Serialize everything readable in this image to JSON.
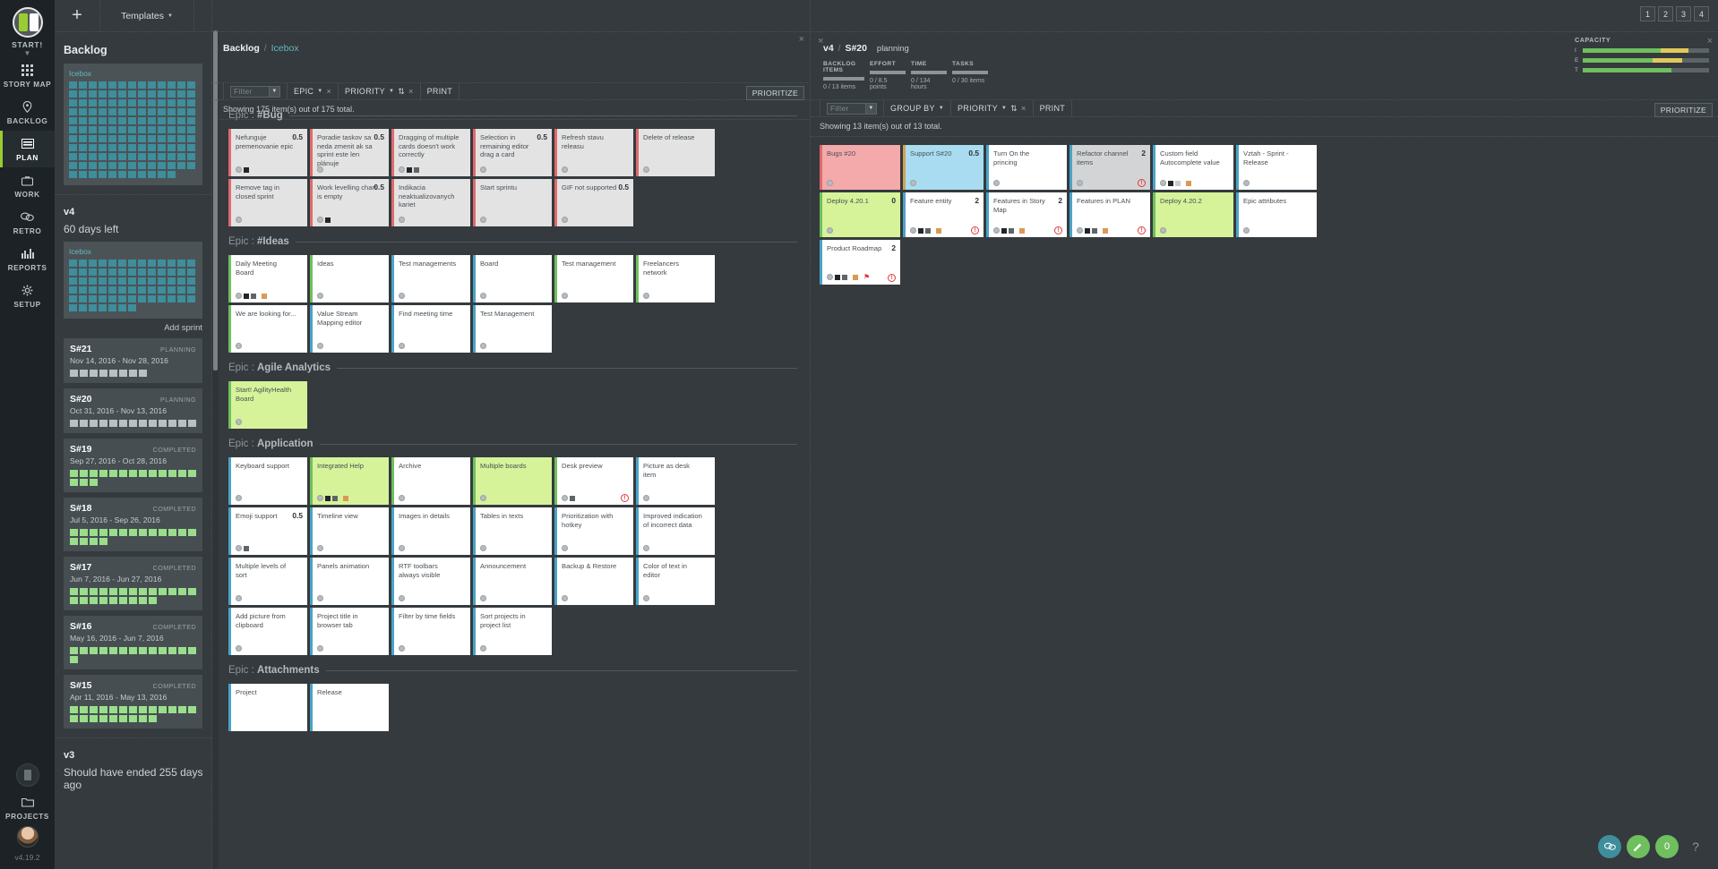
{
  "topbar": {
    "add_label": "+",
    "templates_label": "Templates",
    "pages": [
      "1",
      "2",
      "3",
      "4"
    ]
  },
  "rail": {
    "brand": "START!",
    "items": [
      {
        "label": "STORY MAP",
        "icon": "grid-icon"
      },
      {
        "label": "BACKLOG",
        "icon": "pin-icon"
      },
      {
        "label": "PLAN",
        "icon": "board-icon"
      },
      {
        "label": "WORK",
        "icon": "briefcase-icon"
      },
      {
        "label": "RETRO",
        "icon": "chat-icon"
      },
      {
        "label": "REPORTS",
        "icon": "bars-icon"
      },
      {
        "label": "SETUP",
        "icon": "gear-icon"
      }
    ],
    "projects_label": "PROJECTS",
    "version": "v4.19.2"
  },
  "sidebar": {
    "title": "Backlog",
    "icebox_label": "Icebox",
    "backlog_icebox_chips": 141,
    "release": {
      "name": "v4",
      "subtitle": "60 days left"
    },
    "release_icebox_chips": 72,
    "add_sprint_label": "Add sprint",
    "sprints": [
      {
        "name": "S#21",
        "dates": "Nov 14, 2016 - Nov 28, 2016",
        "status": "PLANNING",
        "chips": 8,
        "color": "grey"
      },
      {
        "name": "S#20",
        "dates": "Oct 31, 2016 - Nov 13, 2016",
        "status": "PLANNING",
        "chips": 13,
        "color": "grey"
      },
      {
        "name": "S#19",
        "dates": "Sep 27, 2016 - Oct 28, 2016",
        "status": "COMPLETED",
        "chips": 16,
        "color": "green"
      },
      {
        "name": "S#18",
        "dates": "Jul 5, 2016 - Sep 26, 2016",
        "status": "COMPLETED",
        "chips": 17,
        "color": "green"
      },
      {
        "name": "S#17",
        "dates": "Jun 7, 2016 - Jun 27, 2016",
        "status": "COMPLETED",
        "chips": 22,
        "color": "green"
      },
      {
        "name": "S#16",
        "dates": "May 16, 2016 - Jun 7, 2016",
        "status": "COMPLETED",
        "chips": 14,
        "color": "green"
      },
      {
        "name": "S#15",
        "dates": "Apr 11, 2016 - May 13, 2016",
        "status": "COMPLETED",
        "chips": 22,
        "color": "green"
      }
    ],
    "release2": {
      "name": "v3",
      "subtitle": "Should have ended 255 days ago"
    }
  },
  "center": {
    "breadcrumb_root": "Backlog",
    "breadcrumb_sep": "/",
    "breadcrumb_current": "Icebox",
    "toolbar": {
      "filter_placeholder": "Filter",
      "epic_label": "EPIC",
      "priority_label": "PRIORITY",
      "print_label": "PRINT",
      "prioritize_label": "PRIORITIZE",
      "clear_label": "×",
      "sort_icon": "sort-icon"
    },
    "showing": "Showing 175 item(s) out of 175 total.",
    "epics": [
      {
        "label_prefix": "Epic :",
        "name": "#Bug",
        "cards": [
          {
            "title": "Nefunguje premenovanie epic",
            "points": "0.5",
            "style": "red",
            "dots": 1,
            "squares": [
              "d"
            ]
          },
          {
            "title": "Poradie taskov sa neda zmenit ak sa sprint este len plánuje",
            "points": "0.5",
            "style": "red",
            "dots": 1,
            "squares": []
          },
          {
            "title": "Dragging of multiple cards doesn't work correctly",
            "points": "",
            "style": "red",
            "dots": 1,
            "squares": [
              "d",
              "g"
            ]
          },
          {
            "title": "Selection in remaining editor drag a card",
            "points": "0.5",
            "style": "red",
            "dots": 1,
            "squares": []
          },
          {
            "title": "Refresh stavu releasu",
            "points": "",
            "style": "red",
            "dots": 1,
            "squares": []
          },
          {
            "title": "Delete of release",
            "points": "",
            "style": "red",
            "dots": 1,
            "squares": []
          },
          {
            "title": "Remove tag in closed sprint",
            "points": "",
            "style": "red",
            "dots": 1,
            "squares": []
          },
          {
            "title": "Work levelling chart is empty",
            "points": "0.5",
            "style": "red",
            "dots": 1,
            "squares": [
              "d"
            ]
          },
          {
            "title": "Indikacia neaktualizovanych kariet",
            "points": "",
            "style": "red",
            "dots": 1,
            "squares": []
          },
          {
            "title": "Start sprintu",
            "points": "",
            "style": "red",
            "dots": 1,
            "squares": []
          },
          {
            "title": "GIF not supported",
            "points": "0.5",
            "style": "red",
            "dots": 1,
            "squares": []
          }
        ]
      },
      {
        "label_prefix": "Epic :",
        "name": "#Ideas",
        "cards": [
          {
            "title": "Daily Meeting Board",
            "points": "",
            "style": "green-b",
            "dots": 1,
            "squares": [
              "d",
              "g",
              "o"
            ]
          },
          {
            "title": "Ideas",
            "points": "",
            "style": "green-b",
            "dots": 1,
            "squares": []
          },
          {
            "title": "Test managements",
            "points": "",
            "style": "",
            "dots": 1,
            "squares": []
          },
          {
            "title": "Board",
            "points": "",
            "style": "",
            "dots": 1,
            "squares": []
          },
          {
            "title": "Test management",
            "points": "",
            "style": "green-b",
            "dots": 1,
            "squares": []
          },
          {
            "title": "Freelancers network",
            "points": "",
            "style": "green-b",
            "dots": 1,
            "squares": []
          },
          {
            "title": "We are looking for...",
            "points": "",
            "style": "green-b",
            "dots": 1,
            "squares": []
          },
          {
            "title": "Value Stream Mapping editor",
            "points": "",
            "style": "",
            "dots": 1,
            "squares": []
          },
          {
            "title": "Find meeting time",
            "points": "",
            "style": "",
            "dots": 1,
            "squares": []
          },
          {
            "title": "Test Management",
            "points": "",
            "style": "",
            "dots": 1,
            "squares": []
          }
        ]
      },
      {
        "label_prefix": "Epic :",
        "name": "Agile Analytics",
        "cards": [
          {
            "title": "Start! AgilityHealth Board",
            "points": "",
            "style": "lime",
            "dots": 1,
            "squares": []
          }
        ]
      },
      {
        "label_prefix": "Epic :",
        "name": "Application",
        "cards": [
          {
            "title": "Keyboard support",
            "points": "",
            "style": "",
            "dots": 1,
            "squares": []
          },
          {
            "title": "Integrated Help",
            "points": "",
            "style": "lime",
            "dots": 1,
            "squares": [
              "d",
              "g",
              "o"
            ]
          },
          {
            "title": "Archive",
            "points": "",
            "style": "green-b",
            "dots": 1,
            "squares": []
          },
          {
            "title": "Multiple boards",
            "points": "",
            "style": "lime",
            "dots": 1,
            "squares": []
          },
          {
            "title": "Desk preview",
            "points": "",
            "style": "green-b",
            "dots": 1,
            "squares": [
              "g"
            ],
            "warn": true
          },
          {
            "title": "Picture as desk item",
            "points": "",
            "style": "",
            "dots": 1,
            "squares": []
          },
          {
            "title": "Emoji support",
            "points": "0.5",
            "style": "",
            "dots": 1,
            "squares": [
              "g"
            ]
          },
          {
            "title": "Timeline view",
            "points": "",
            "style": "",
            "dots": 1,
            "squares": []
          },
          {
            "title": "Images in details",
            "points": "",
            "style": "",
            "dots": 1,
            "squares": []
          },
          {
            "title": "Tables in texts",
            "points": "",
            "style": "",
            "dots": 1,
            "squares": []
          },
          {
            "title": "Prioritization with hotkey",
            "points": "",
            "style": "",
            "dots": 1,
            "squares": []
          },
          {
            "title": "Improved indication of incorrect data",
            "points": "",
            "style": "",
            "dots": 1,
            "squares": []
          },
          {
            "title": "Multiple levels of sort",
            "points": "",
            "style": "",
            "dots": 1,
            "squares": []
          },
          {
            "title": "Panels animation",
            "points": "",
            "style": "",
            "dots": 1,
            "squares": []
          },
          {
            "title": "RTF toolbars always visible",
            "points": "",
            "style": "",
            "dots": 1,
            "squares": []
          },
          {
            "title": "Announcement",
            "points": "",
            "style": "",
            "dots": 1,
            "squares": []
          },
          {
            "title": "Backup & Restore",
            "points": "",
            "style": "",
            "dots": 1,
            "squares": []
          },
          {
            "title": "Color of text in editor",
            "points": "",
            "style": "",
            "dots": 1,
            "squares": []
          },
          {
            "title": "Add picture from clipboard",
            "points": "",
            "style": "",
            "dots": 1,
            "squares": []
          },
          {
            "title": "Project title in browser tab",
            "points": "",
            "style": "",
            "dots": 1,
            "squares": []
          },
          {
            "title": "Filter by time fields",
            "points": "",
            "style": "",
            "dots": 1,
            "squares": []
          },
          {
            "title": "Sort projects in project list",
            "points": "",
            "style": "",
            "dots": 1,
            "squares": []
          }
        ]
      },
      {
        "label_prefix": "Epic :",
        "name": "Attachments",
        "cards": [
          {
            "title": "Project",
            "points": "",
            "style": "",
            "dots": 0,
            "squares": []
          },
          {
            "title": "Release",
            "points": "",
            "style": "",
            "dots": 0,
            "squares": []
          }
        ]
      }
    ]
  },
  "right": {
    "breadcrumb_release": "v4",
    "breadcrumb_sep": "/",
    "breadcrumb_sprint": "S#20",
    "status": "planning",
    "metrics": [
      {
        "label": "BACKLOG ITEMS",
        "value": "0 / 13 items",
        "progress": 0
      },
      {
        "label": "EFFORT",
        "value": "0 / 8.5 points",
        "progress": 0
      },
      {
        "label": "TIME",
        "value": "0 / 134 hours",
        "progress": 0
      },
      {
        "label": "TASKS",
        "value": "0 / 30 items",
        "progress": 0
      }
    ],
    "capacity": {
      "title": "CAPACITY",
      "rows": [
        {
          "key": "I",
          "green_pct": 62,
          "yellow_pct": 22
        },
        {
          "key": "E",
          "green_pct": 55,
          "yellow_pct": 24
        },
        {
          "key": "T",
          "green_pct": 70,
          "yellow_pct": 0
        }
      ]
    },
    "toolbar": {
      "filter_placeholder": "Filter",
      "group_by_label": "GROUP BY",
      "priority_label": "PRIORITY",
      "print_label": "PRINT",
      "prioritize_label": "PRIORITIZE",
      "clear_label": "×",
      "sort_icon": "sort-icon"
    },
    "showing": "Showing 13 item(s) out of 13 total.",
    "cards": [
      {
        "title": "Bugs #20",
        "points": "",
        "style": "pink",
        "dots": 1,
        "squares": []
      },
      {
        "title": "Support S#20",
        "points": "0.5",
        "style": "blue",
        "dots": 1,
        "squares": []
      },
      {
        "title": "Turn On the princing",
        "points": "",
        "style": "",
        "dots": 1,
        "squares": []
      },
      {
        "title": "Refactor channel items",
        "points": "2",
        "style": "silver",
        "dots": 1,
        "squares": [],
        "warn": true
      },
      {
        "title": "Custom field Autocomplete value",
        "points": "",
        "style": "",
        "dots": 1,
        "squares": [
          "d",
          "l",
          "o"
        ]
      },
      {
        "title": "Vztah - Sprint - Release",
        "points": "",
        "style": "",
        "dots": 1,
        "squares": []
      },
      {
        "title": "Deploy 4.20.1",
        "points": "0",
        "style": "lime",
        "dots": 1,
        "squares": []
      },
      {
        "title": "Feature entity",
        "points": "2",
        "style": "",
        "dots": 1,
        "squares": [
          "d",
          "g",
          "o"
        ],
        "warn": true
      },
      {
        "title": "Features in Story Map",
        "points": "2",
        "style": "",
        "dots": 1,
        "squares": [
          "d",
          "g",
          "o"
        ],
        "warn": true
      },
      {
        "title": "Features in PLAN",
        "points": "",
        "style": "",
        "dots": 1,
        "squares": [
          "d",
          "g",
          "o"
        ],
        "warn": true
      },
      {
        "title": "Deploy 4.20.2",
        "points": "",
        "style": "lime",
        "dots": 1,
        "squares": []
      },
      {
        "title": "Epic attributes",
        "points": "",
        "style": "",
        "dots": 1,
        "squares": []
      },
      {
        "title": "Product Roadmap",
        "points": "2",
        "style": "",
        "dots": 1,
        "squares": [
          "d",
          "g",
          "o"
        ],
        "warn": true,
        "flag": true
      }
    ]
  },
  "fabs": [
    {
      "name": "chat-fab",
      "glyph": "●"
    },
    {
      "name": "edit-fab",
      "glyph": "✎"
    },
    {
      "name": "count-fab",
      "glyph": "0"
    },
    {
      "name": "help-fab",
      "glyph": "?"
    }
  ]
}
